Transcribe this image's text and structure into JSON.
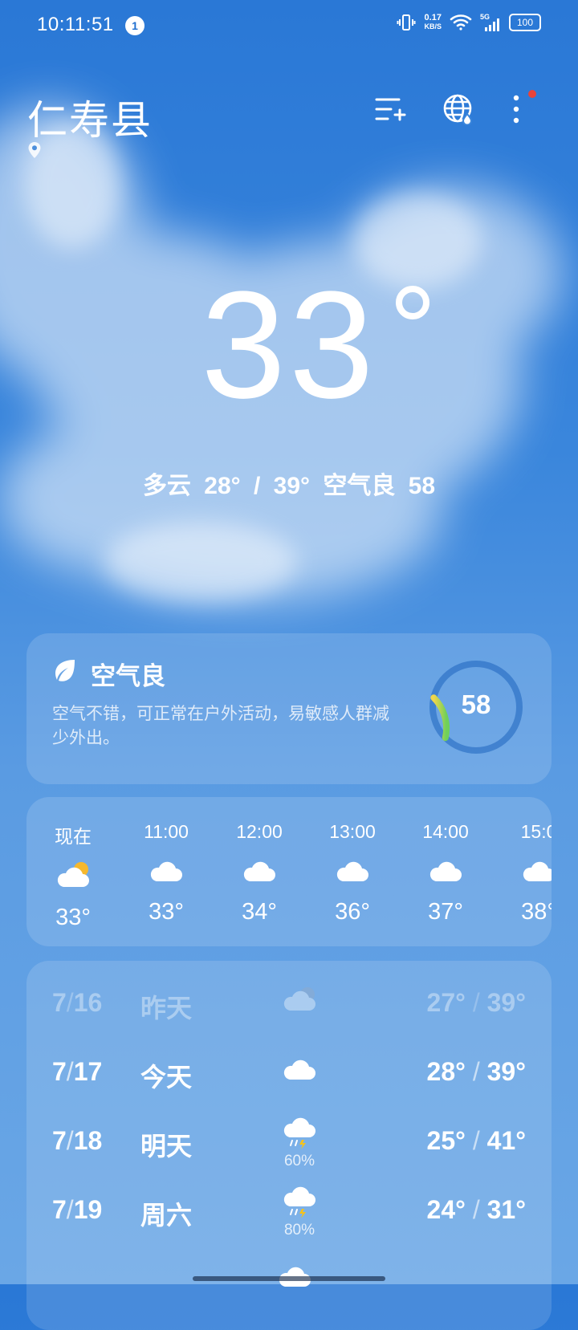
{
  "status_bar": {
    "time": "10:11:51",
    "notification_count": "1",
    "net_speed_value": "0.17",
    "net_speed_unit": "KB/S",
    "network_type": "5G",
    "battery": "100"
  },
  "header": {
    "city": "仁寿县",
    "icons": [
      "location-pin-icon",
      "manage-cities-icon",
      "globe-weather-icon",
      "more-icon"
    ]
  },
  "current": {
    "temperature": "33",
    "summary": "多云  28° / 39°  空气良 58"
  },
  "air_quality": {
    "title": "空气良",
    "description": "空气不错，可正常在户外活动，易敏感人群减少外出。",
    "value": "58",
    "gauge_fraction": 0.16,
    "gauge_colors": [
      "#f2d64b",
      "#6fd05a"
    ]
  },
  "hourly": [
    {
      "time": "现在",
      "icon": "partly-cloudy-sun-icon",
      "temp": "33°"
    },
    {
      "time": "11:00",
      "icon": "cloud-icon",
      "temp": "33°"
    },
    {
      "time": "12:00",
      "icon": "cloud-icon",
      "temp": "34°"
    },
    {
      "time": "13:00",
      "icon": "cloud-icon",
      "temp": "36°"
    },
    {
      "time": "14:00",
      "icon": "cloud-icon",
      "temp": "37°"
    },
    {
      "time": "15:0",
      "icon": "cloud-icon",
      "temp": "38°"
    }
  ],
  "daily": [
    {
      "month": "7",
      "day": "16",
      "name": "昨天",
      "icon": "partly-cloudy-moon-icon",
      "pop": "",
      "low": "27°",
      "high": "39°",
      "faded": true
    },
    {
      "month": "7",
      "day": "17",
      "name": "今天",
      "icon": "cloud-icon",
      "pop": "",
      "low": "28°",
      "high": "39°",
      "faded": false
    },
    {
      "month": "7",
      "day": "18",
      "name": "明天",
      "icon": "thunder-rain-icon",
      "pop": "60%",
      "low": "25°",
      "high": "41°",
      "faded": false
    },
    {
      "month": "7",
      "day": "19",
      "name": "周六",
      "icon": "thunder-rain-icon",
      "pop": "80%",
      "low": "24°",
      "high": "31°",
      "faded": false
    }
  ]
}
